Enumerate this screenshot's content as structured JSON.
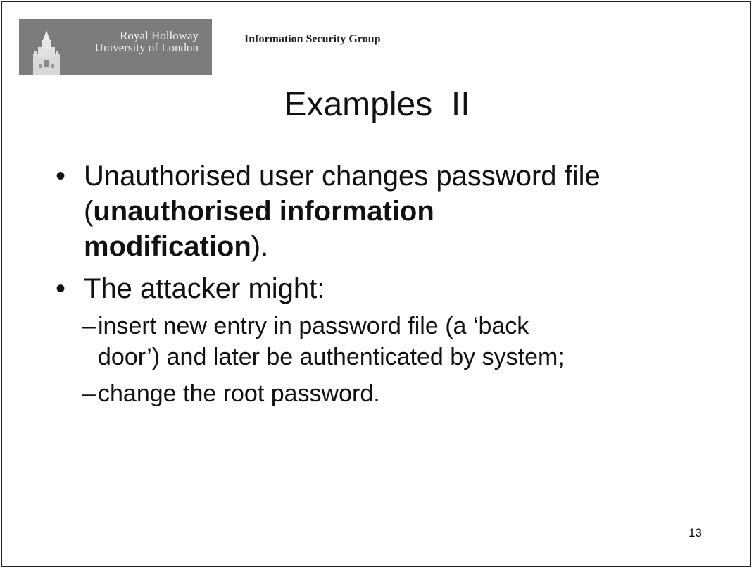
{
  "header": {
    "logo": {
      "name": "Royal Holloway",
      "subtitle": "University of London"
    },
    "group": "Information Security Group"
  },
  "slide": {
    "title": "Examples  II",
    "bullets": [
      {
        "marker": "•",
        "line1": "Unauthorised user changes password file",
        "line2_open": "(",
        "line2_bold": "unauthorised information",
        "line3_bold": "modification",
        "line3_close": ")."
      },
      {
        "marker": "•",
        "text": "The attacker might:",
        "subitems": [
          {
            "marker": "–",
            "line1": "insert new entry in password file (a ‘back",
            "line2": "door’) and later be authenticated by system;"
          },
          {
            "marker": "–",
            "line1": "change the root password."
          }
        ]
      }
    ],
    "page_number": "13"
  }
}
